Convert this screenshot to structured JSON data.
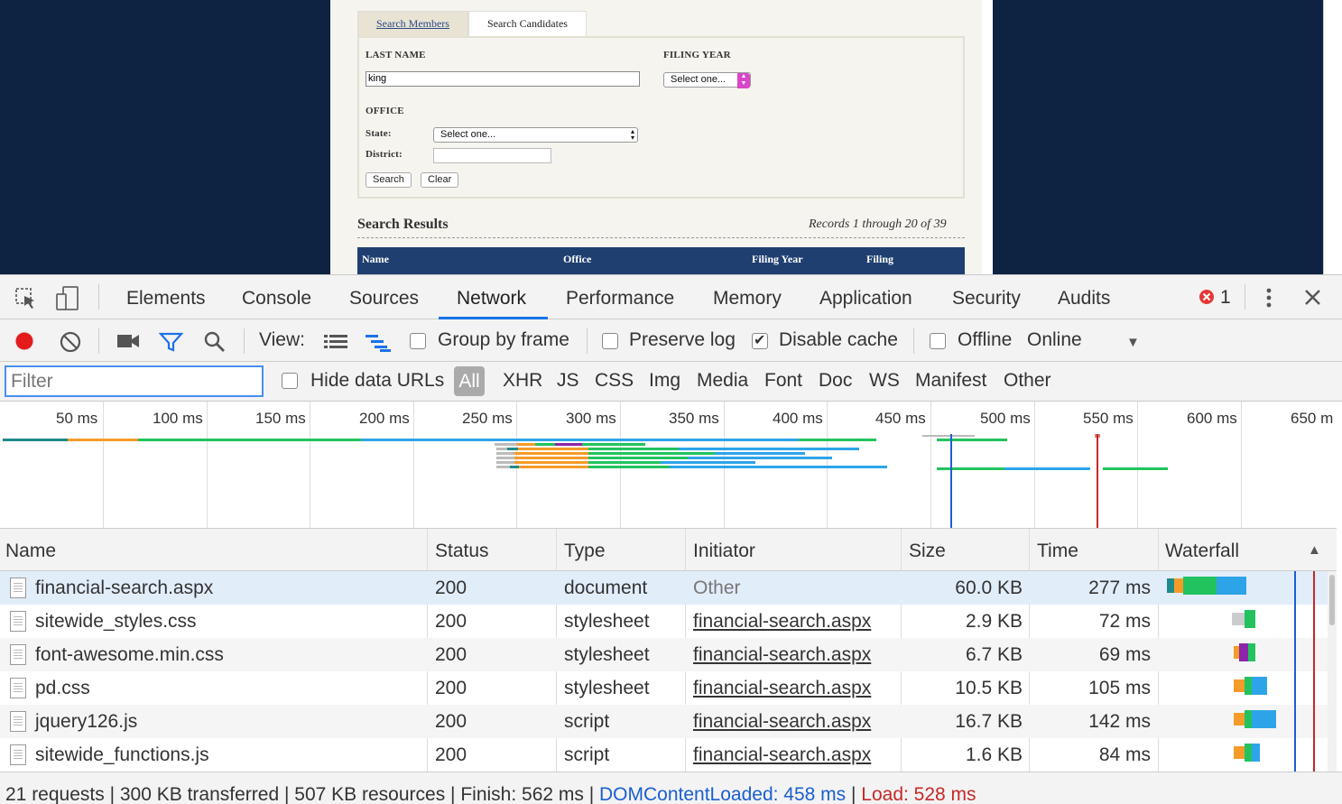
{
  "page": {
    "tabs": [
      {
        "label": "Search Members"
      },
      {
        "label": "Search Candidates"
      }
    ],
    "last_name_label": "LAST NAME",
    "last_name_value": "king",
    "filing_year_label": "FILING YEAR",
    "filing_year_value": "Select one...",
    "office_label": "OFFICE",
    "state_label": "State:",
    "state_value": "Select one...",
    "district_label": "District:",
    "district_value": "",
    "search_button": "Search",
    "clear_button": "Clear",
    "results_title": "Search Results",
    "records_text": "Records 1 through 20 of 39",
    "result_columns": [
      "Name",
      "Office",
      "Filing Year",
      "Filing"
    ]
  },
  "devtools": {
    "tabs": [
      "Elements",
      "Console",
      "Sources",
      "Network",
      "Performance",
      "Memory",
      "Application",
      "Security",
      "Audits"
    ],
    "active_tab": "Network",
    "error_count": "1",
    "toolbar": {
      "view_label": "View:",
      "group_by_frame": "Group by frame",
      "preserve_log": "Preserve log",
      "disable_cache": "Disable cache",
      "offline": "Offline",
      "throttling": "Online",
      "group_by_frame_checked": false,
      "preserve_log_checked": false,
      "disable_cache_checked": true,
      "offline_checked": false
    },
    "filter": {
      "placeholder": "Filter",
      "hide_data_urls": "Hide data URLs",
      "types": [
        "All",
        "XHR",
        "JS",
        "CSS",
        "Img",
        "Media",
        "Font",
        "Doc",
        "WS",
        "Manifest",
        "Other"
      ],
      "active_type": "All"
    },
    "overview_ticks": [
      "50 ms",
      "100 ms",
      "150 ms",
      "200 ms",
      "250 ms",
      "300 ms",
      "350 ms",
      "400 ms",
      "450 ms",
      "500 ms",
      "550 ms",
      "600 ms",
      "650 m"
    ],
    "columns": [
      "Name",
      "Status",
      "Type",
      "Initiator",
      "Size",
      "Time",
      "Waterfall"
    ],
    "rows": [
      {
        "name": "financial-search.aspx",
        "status": "200",
        "type": "document",
        "initiator": "Other",
        "size": "60.0 KB",
        "time": "277 ms"
      },
      {
        "name": "sitewide_styles.css",
        "status": "200",
        "type": "stylesheet",
        "initiator": "financial-search.aspx",
        "size": "2.9 KB",
        "time": "72 ms"
      },
      {
        "name": "font-awesome.min.css",
        "status": "200",
        "type": "stylesheet",
        "initiator": "financial-search.aspx",
        "size": "6.7 KB",
        "time": "69 ms"
      },
      {
        "name": "pd.css",
        "status": "200",
        "type": "stylesheet",
        "initiator": "financial-search.aspx",
        "size": "10.5 KB",
        "time": "105 ms"
      },
      {
        "name": "jquery126.js",
        "status": "200",
        "type": "script",
        "initiator": "financial-search.aspx",
        "size": "16.7 KB",
        "time": "142 ms"
      },
      {
        "name": "sitewide_functions.js",
        "status": "200",
        "type": "script",
        "initiator": "financial-search.aspx",
        "size": "1.6 KB",
        "time": "84 ms"
      }
    ],
    "status": {
      "requests": "21 requests",
      "transferred": "300 KB transferred",
      "resources": "507 KB resources",
      "finish": "Finish: 562 ms",
      "dom_content_loaded": "DOMContentLoaded: 458 ms",
      "load": "Load: 528 ms"
    },
    "colors": {
      "accent": "#1a73e8",
      "dcl_line": "#1a5fd1",
      "load_line": "#c62828",
      "waiting": "#22c35e",
      "download": "#2ea4e8",
      "queue": "#f59b2a"
    }
  }
}
